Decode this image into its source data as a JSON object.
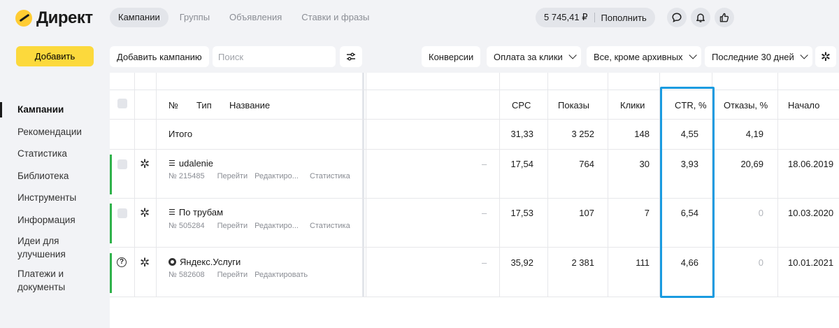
{
  "header": {
    "logo_text": "Директ",
    "tabs": [
      {
        "label": "Кампании",
        "active": true
      },
      {
        "label": "Группы",
        "active": false
      },
      {
        "label": "Объявления",
        "active": false
      },
      {
        "label": "Ставки и фразы",
        "active": false
      }
    ],
    "balance": "5 745,41 ₽",
    "topup_label": "Пополнить",
    "icons": [
      "chat-icon",
      "bell-icon",
      "thumbs-up-icon"
    ]
  },
  "sidebar": {
    "add_label": "Добавить",
    "items": [
      {
        "label": "Кампании",
        "active": true
      },
      {
        "label": "Рекомендации"
      },
      {
        "label": "Статистика"
      },
      {
        "label": "Библиотека"
      },
      {
        "label": "Инструменты"
      },
      {
        "label": "Информация"
      },
      {
        "label": "Идеи для улучшения"
      },
      {
        "label": "Платежи и документы"
      }
    ]
  },
  "toolbar": {
    "add_campaign_label": "Добавить кампанию",
    "search_placeholder": "Поиск",
    "conversions_label": "Конверсии",
    "payment_label": "Оплата за клики",
    "filter_label": "Все, кроме архивных",
    "period_label": "Последние 30 дней"
  },
  "table": {
    "headers": {
      "num": "№",
      "type": "Тип",
      "name": "Название",
      "cpc": "CPC",
      "shows": "Показы",
      "clicks": "Клики",
      "ctr": "CTR, %",
      "bounce": "Отказы, %",
      "start": "Начало"
    },
    "total": {
      "label": "Итого",
      "cpc": "31,33",
      "shows": "3 252",
      "clicks": "148",
      "ctr": "4,55",
      "bounce": "4,19"
    },
    "rows": [
      {
        "name": "udalenie",
        "id": "№ 215485",
        "links": [
          "Перейти",
          "Редактиро...",
          "Статистика"
        ],
        "dash": "–",
        "cpc": "17,54",
        "shows": "764",
        "clicks": "30",
        "ctr": "3,93",
        "bounce": "20,69",
        "start": "18.06.2019"
      },
      {
        "name": "По трубам",
        "id": "№ 505284",
        "links": [
          "Перейти",
          "Редактиро...",
          "Статистика"
        ],
        "dash": "–",
        "cpc": "17,53",
        "shows": "107",
        "clicks": "7",
        "ctr": "6,54",
        "bounce": "0",
        "start": "10.03.2020"
      },
      {
        "name": "Яндекс.Услуги",
        "id": "№ 582608",
        "links": [
          "Перейти",
          "Редактировать"
        ],
        "dash": "–",
        "cpc": "35,92",
        "shows": "2 381",
        "clicks": "111",
        "ctr": "4,66",
        "bounce": "0",
        "start": "10.01.2021"
      }
    ]
  },
  "colors": {
    "accent": "#fcd93c",
    "highlight": "#1a9be0",
    "active_status": "#2fb24a"
  }
}
